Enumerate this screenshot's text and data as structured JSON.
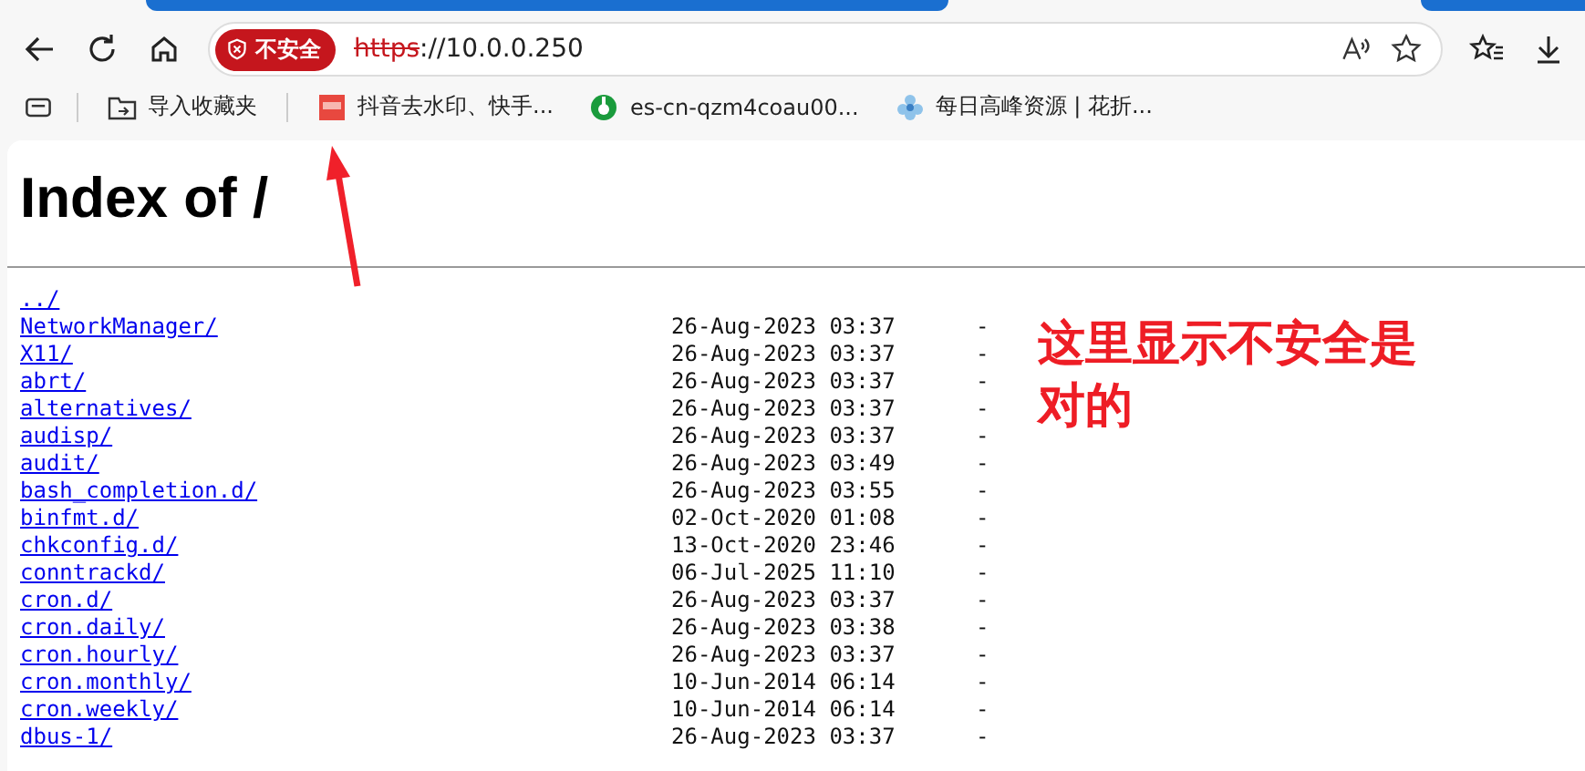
{
  "browser": {
    "security_badge": "不安全",
    "url_scheme": "https",
    "url_rest": "://10.0.0.250"
  },
  "bookmarks": [
    {
      "label": "导入收藏夹",
      "kind": "import"
    },
    {
      "label": "抖音去水印、快手...",
      "kind": "red"
    },
    {
      "label": "es-cn-qzm4coau00...",
      "kind": "green"
    },
    {
      "label": "每日高峰资源 | 花折...",
      "kind": "flower"
    }
  ],
  "page": {
    "title": "Index of /",
    "entries": [
      {
        "name": "../"
      },
      {
        "name": "NetworkManager/",
        "date": "26-Aug-2023 03:37",
        "size": "-"
      },
      {
        "name": "X11/",
        "date": "26-Aug-2023 03:37",
        "size": "-"
      },
      {
        "name": "abrt/",
        "date": "26-Aug-2023 03:37",
        "size": "-"
      },
      {
        "name": "alternatives/",
        "date": "26-Aug-2023 03:37",
        "size": "-"
      },
      {
        "name": "audisp/",
        "date": "26-Aug-2023 03:37",
        "size": "-"
      },
      {
        "name": "audit/",
        "date": "26-Aug-2023 03:49",
        "size": "-"
      },
      {
        "name": "bash_completion.d/",
        "date": "26-Aug-2023 03:55",
        "size": "-"
      },
      {
        "name": "binfmt.d/",
        "date": "02-Oct-2020 01:08",
        "size": "-"
      },
      {
        "name": "chkconfig.d/",
        "date": "13-Oct-2020 23:46",
        "size": "-"
      },
      {
        "name": "conntrackd/",
        "date": "06-Jul-2025 11:10",
        "size": "-"
      },
      {
        "name": "cron.d/",
        "date": "26-Aug-2023 03:37",
        "size": "-"
      },
      {
        "name": "cron.daily/",
        "date": "26-Aug-2023 03:38",
        "size": "-"
      },
      {
        "name": "cron.hourly/",
        "date": "26-Aug-2023 03:37",
        "size": "-"
      },
      {
        "name": "cron.monthly/",
        "date": "10-Jun-2014 06:14",
        "size": "-"
      },
      {
        "name": "cron.weekly/",
        "date": "10-Jun-2014 06:14",
        "size": "-"
      },
      {
        "name": "dbus-1/",
        "date": "26-Aug-2023 03:37",
        "size": "-"
      }
    ]
  },
  "annotation": {
    "text": "这里显示不安全是对的"
  }
}
